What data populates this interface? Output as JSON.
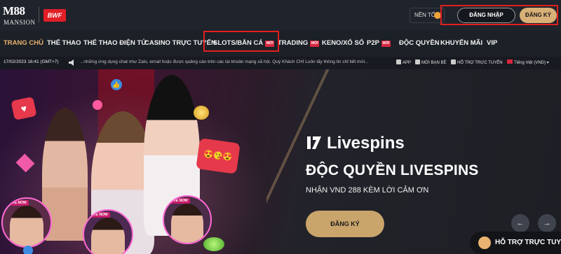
{
  "header": {
    "logo_text": "M88",
    "logo_sub": "MANSION",
    "partner_logo": "BWF",
    "night_mode_label": "NỀN TỐI",
    "login_label": "ĐĂNG NHẬP",
    "register_label": "ĐĂNG KÝ"
  },
  "nav": {
    "items": [
      {
        "label": "TRANG CHỦ",
        "active": true
      },
      {
        "label": "THỂ THAO"
      },
      {
        "label": "THỂ THAO ĐIỆN TỬ"
      },
      {
        "label": "CASINO TRỰC TUYẾN"
      },
      {
        "label": "SLOTS/BẮN CÁ",
        "badge": "MỚI"
      },
      {
        "label": "TRADING",
        "badge": "MỚI"
      },
      {
        "label": "KENO/XỔ SỐ"
      },
      {
        "label": "P2P",
        "badge": "MỚI"
      },
      {
        "label": "ĐỘC QUYỀN"
      },
      {
        "label": "KHUYẾN MÃI"
      },
      {
        "label": "VIP"
      }
    ]
  },
  "ticker": {
    "datetime": "17/02/2023 16:41 (GMT+7)",
    "message": "...những ứng dụng chat như Zalo, email hoặc được quảng cáo trên các tài khoản mạng xã hội. Quý Khách CHỈ Luôn lấy thông tin chỉ tiết mới...",
    "app_label": "APP",
    "invite_label": "MỜI BẠN BÈ",
    "support_label": "HỖ TRỢ TRỰC TUYẾN",
    "language_label": "Tiếng Việt (VND)"
  },
  "banner": {
    "live_label": "LIVE NOW",
    "brand": "Livespins",
    "title": "ĐỘC QUYỀN LIVESPINS",
    "subtitle": "NHẬN VND 288 KÈM LỜI CẢM ƠN",
    "cta_label": "ĐĂNG KÝ",
    "prev_icon": "arrow-left-icon",
    "next_icon": "arrow-right-icon"
  },
  "support_widget": {
    "label": "HỖ TRỢ TRỰC TUYẾN"
  },
  "colors": {
    "accent_gold": "#d9b077",
    "badge_red": "#d8273f",
    "highlight_red": "#e02020",
    "background": "#1a1d24"
  }
}
